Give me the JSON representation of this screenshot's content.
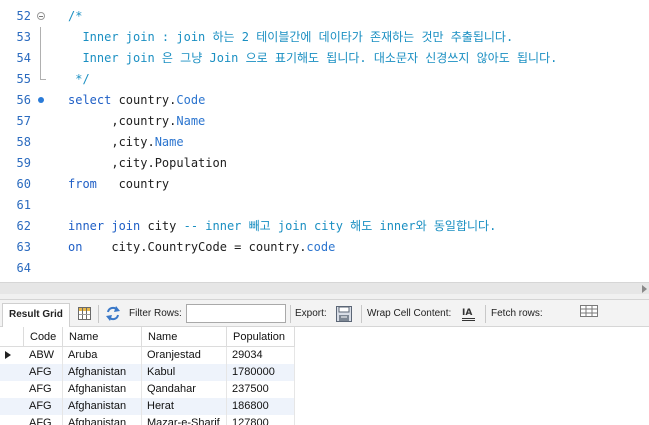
{
  "editor": {
    "lines": [
      {
        "num": "52",
        "segments": [
          {
            "t": "/*",
            "c": "cm"
          }
        ]
      },
      {
        "num": "53",
        "segments": [
          {
            "t": "  Inner join : join 하는 2 테이블간에 데이타가 존재하는 것만 추출됩니다.",
            "c": "cm"
          }
        ]
      },
      {
        "num": "54",
        "segments": [
          {
            "t": "  Inner join 은 그냥 Join 으로 표기해도 됩니다. 대소문자 신경쓰지 않아도 됩니다.",
            "c": "cm"
          }
        ]
      },
      {
        "num": "55",
        "segments": [
          {
            "t": " */",
            "c": "cm"
          }
        ]
      },
      {
        "num": "56",
        "segments": [
          {
            "t": "select",
            "c": "kw"
          },
          {
            "t": " country.",
            "c": "tx"
          },
          {
            "t": "Code",
            "c": "fld"
          }
        ]
      },
      {
        "num": "57",
        "segments": [
          {
            "t": "      ,country.",
            "c": "tx"
          },
          {
            "t": "Name",
            "c": "fld"
          }
        ]
      },
      {
        "num": "58",
        "segments": [
          {
            "t": "      ,city.",
            "c": "tx"
          },
          {
            "t": "Name",
            "c": "fld"
          }
        ]
      },
      {
        "num": "59",
        "segments": [
          {
            "t": "      ,city.Population",
            "c": "tx"
          }
        ]
      },
      {
        "num": "60",
        "segments": [
          {
            "t": "from",
            "c": "kw"
          },
          {
            "t": "   country",
            "c": "tx"
          }
        ]
      },
      {
        "num": "61",
        "segments": []
      },
      {
        "num": "62",
        "segments": [
          {
            "t": "inner join",
            "c": "kw"
          },
          {
            "t": " city ",
            "c": "tx"
          },
          {
            "t": "-- inner 빼고 join city 해도 inner와 동일합니다.",
            "c": "cm"
          }
        ]
      },
      {
        "num": "63",
        "segments": [
          {
            "t": "on",
            "c": "kw"
          },
          {
            "t": "    city.CountryCode = country.",
            "c": "tx"
          },
          {
            "t": "code",
            "c": "fld"
          }
        ]
      },
      {
        "num": "64",
        "segments": []
      }
    ]
  },
  "toolbar": {
    "result_grid_label": "Result Grid",
    "filter_rows_label": "Filter Rows:",
    "filter_value": "",
    "export_label": "Export:",
    "wrap_cell_label": "Wrap Cell Content:",
    "fetch_rows_label": "Fetch rows:",
    "icons": [
      "grid-view-icon",
      "refresh-icon",
      "export-file-icon",
      "wrap-text-icon",
      "fetch-rows-icon"
    ]
  },
  "grid": {
    "columns": [
      "Code",
      "Name",
      "Name",
      "Population"
    ],
    "rows": [
      [
        "ABW",
        "Aruba",
        "Oranjestad",
        "29034"
      ],
      [
        "AFG",
        "Afghanistan",
        "Kabul",
        "1780000"
      ],
      [
        "AFG",
        "Afghanistan",
        "Qandahar",
        "237500"
      ],
      [
        "AFG",
        "Afghanistan",
        "Herat",
        "186800"
      ],
      [
        "AFG",
        "Afghanistan",
        "Mazar-e-Sharif",
        "127800"
      ]
    ]
  },
  "colors": {
    "keyword": "#1f5fc6",
    "comment": "#1a8fc2",
    "line_number": "#2b6bbf",
    "row_alt": "#eef3fb"
  }
}
